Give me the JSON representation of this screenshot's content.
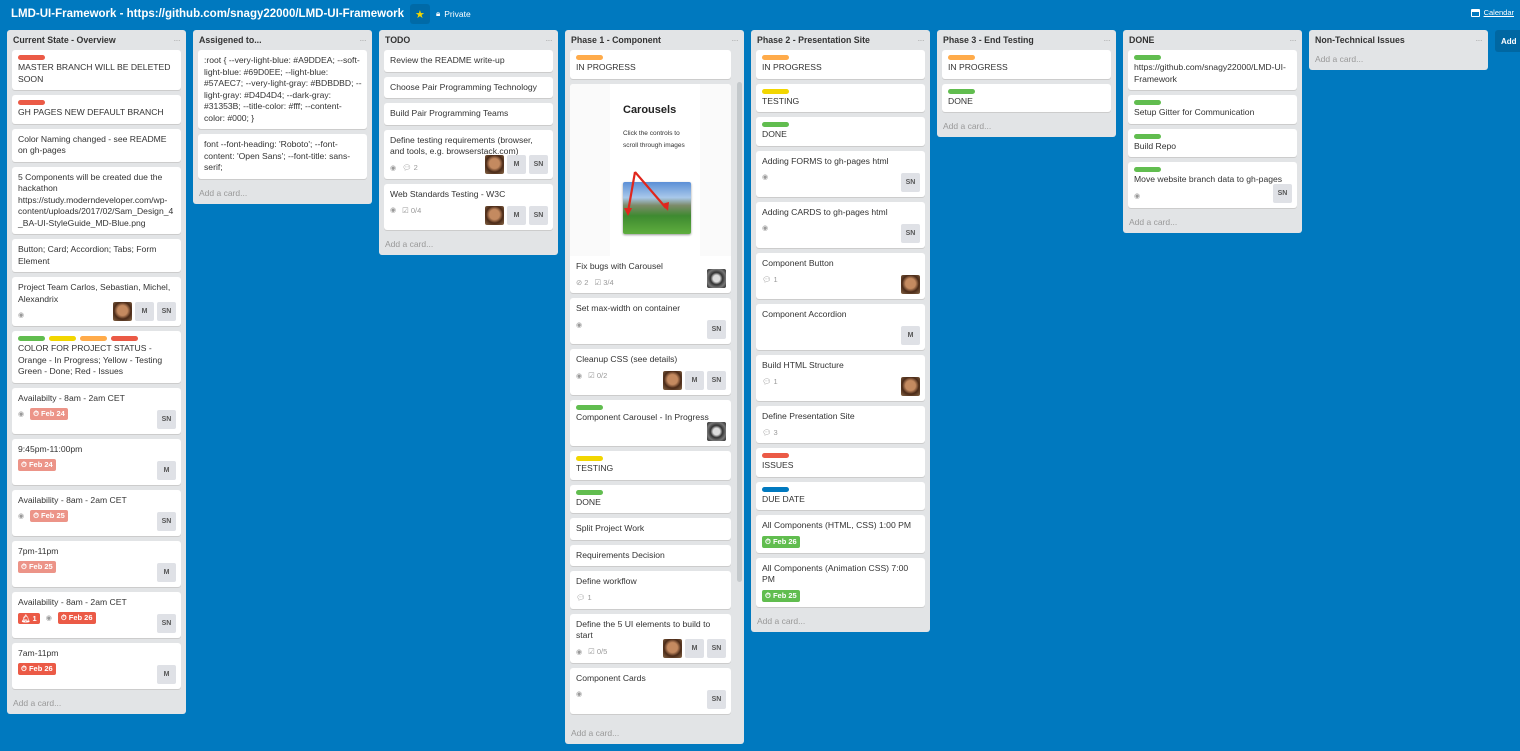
{
  "header": {
    "board_title": "LMD-UI-Framework - https://github.com/snagy22000/LMD-UI-Framework",
    "visibility": "Private",
    "calendar_label": "Calendar",
    "star_icon": "star-icon",
    "lock_icon": "lock-icon"
  },
  "label_colors": {
    "green": "#61bd4f",
    "yellow": "#f2d600",
    "orange": "#ffab4a",
    "red": "#eb5a46",
    "blue": "#0079bf"
  },
  "add_card_label": "Add a card...",
  "add_list_label": "Add",
  "lists": [
    {
      "title": "Current State - Overview",
      "cards": [
        {
          "labels": [
            "red"
          ],
          "text": "MASTER BRANCH WILL BE DELETED SOON"
        },
        {
          "labels": [
            "red"
          ],
          "text": "GH PAGES NEW DEFAULT BRANCH"
        },
        {
          "text": "Color Naming changed - see README on gh-pages"
        },
        {
          "text": "5 Components will be created due the hackathon https://study.moderndeveloper.com/wp-content/uploads/2017/02/Sam_Design_4_BA-UI-StyleGuide_MD-Blue.png"
        },
        {
          "text": "Button; Card; Accordion; Tabs; Form Element"
        },
        {
          "text": "Project Team Carlos, Sebastian, Michel, Alexandrix",
          "watch": true,
          "members": [
            "photo",
            "M",
            "SN"
          ]
        },
        {
          "labels": [
            "green",
            "yellow",
            "orange",
            "red"
          ],
          "text": "COLOR FOR PROJECT STATUS - Orange - In Progress; Yellow - Testing Green - Done; Red - Issues"
        },
        {
          "text": "Availabilty - 8am - 2am CET",
          "watch": true,
          "due": "Feb 24",
          "due_style": "light",
          "members": [
            "SN"
          ]
        },
        {
          "text": "9:45pm-11:00pm",
          "due": "Feb 24",
          "due_style": "light",
          "members": [
            "M"
          ]
        },
        {
          "text": "Availability - 8am - 2am CET",
          "watch": true,
          "due": "Feb 25",
          "due_style": "light",
          "members": [
            "SN"
          ]
        },
        {
          "text": "7pm-11pm",
          "due": "Feb 25",
          "due_style": "light",
          "members": [
            "M"
          ]
        },
        {
          "text": "Availability - 8am - 2am CET",
          "notifications": "1",
          "watch": true,
          "due": "Feb 26",
          "due_style": "red",
          "members": [
            "SN"
          ]
        },
        {
          "text": "7am-11pm",
          "due": "Feb 26",
          "due_style": "red",
          "members": [
            "M"
          ]
        }
      ]
    },
    {
      "title": "Assigened to...",
      "cards": [
        {
          "text": ":root { --very-light-blue: #A9DDEA; --soft-light-blue: #69D0EE; --light-blue: #57AEC7; --very-light-gray: #BDBDBD; --light-gray: #D4D4D4; --dark-gray: #31353B; --title-color: #fff; --content-color: #000; }"
        },
        {
          "text": "font --font-heading: 'Roboto'; --font-content: 'Open Sans'; --font-title: sans-serif;"
        }
      ]
    },
    {
      "title": "TODO",
      "cards": [
        {
          "text": "Review the README write-up"
        },
        {
          "text": "Choose Pair Programming Technology"
        },
        {
          "text": "Build Pair Programming Teams"
        },
        {
          "text": "Define testing requirements (browser, and tools, e.g. browserstack.com)",
          "watch": true,
          "comments": "2",
          "members": [
            "photo",
            "M",
            "SN"
          ]
        },
        {
          "text": "Web Standards Testing - W3C",
          "watch": true,
          "checklist": "0/4",
          "members": [
            "photo",
            "M",
            "SN"
          ]
        }
      ]
    },
    {
      "title": "Phase 1 - Component",
      "scroll": true,
      "cards": [
        {
          "labels": [
            "orange"
          ],
          "text": "IN PROGRESS"
        },
        {
          "cover": {
            "title": "Carousels",
            "desc": "Click the controls to scroll through images"
          },
          "text": "Fix bugs with Carousel",
          "attachments": "2",
          "checklist": "3/4",
          "members": [
            "photo2"
          ]
        },
        {
          "text": "Set max-width on container",
          "watch": true,
          "members": [
            "SN"
          ]
        },
        {
          "text": "Cleanup CSS (see details)",
          "watch": true,
          "checklist": "0/2",
          "members": [
            "photo",
            "M",
            "SN"
          ]
        },
        {
          "labels": [
            "green"
          ],
          "text": "Component Carousel - In Progress",
          "members": [
            "photo2"
          ]
        },
        {
          "labels": [
            "yellow"
          ],
          "text": "TESTING"
        },
        {
          "labels": [
            "green"
          ],
          "text": "DONE"
        },
        {
          "text": "Split Project Work"
        },
        {
          "text": "Requirements Decision"
        },
        {
          "text": "Define workflow",
          "comments": "1"
        },
        {
          "text": "Define the 5 UI elements to build to start",
          "watch": true,
          "checklist": "0/5",
          "members": [
            "photo",
            "M",
            "SN"
          ]
        },
        {
          "text": "Component Cards",
          "watch": true,
          "members": [
            "SN"
          ]
        }
      ]
    },
    {
      "title": "Phase 2 - Presentation Site",
      "cards": [
        {
          "labels": [
            "orange"
          ],
          "text": "IN PROGRESS"
        },
        {
          "labels": [
            "yellow"
          ],
          "text": "TESTING"
        },
        {
          "labels": [
            "green"
          ],
          "text": "DONE"
        },
        {
          "text": "Adding FORMS to gh-pages html",
          "watch": true,
          "members": [
            "SN"
          ]
        },
        {
          "text": "Adding CARDS to gh-pages html",
          "watch": true,
          "members": [
            "SN"
          ]
        },
        {
          "text": "Component Button",
          "comments": "1",
          "members": [
            "photo"
          ]
        },
        {
          "text": "Component Accordion",
          "members": [
            "M"
          ]
        },
        {
          "text": "Build HTML Structure",
          "comments": "1",
          "members": [
            "photo"
          ]
        },
        {
          "text": "Define Presentation Site",
          "comments": "3"
        },
        {
          "labels": [
            "red"
          ],
          "text": "ISSUES"
        },
        {
          "labels": [
            "blue"
          ],
          "text": "DUE DATE"
        },
        {
          "text": "All Components (HTML, CSS) 1:00 PM",
          "due": "Feb 26",
          "due_style": "green"
        },
        {
          "text": "All Components (Animation CSS) 7:00 PM",
          "due": "Feb 25",
          "due_style": "green"
        }
      ]
    },
    {
      "title": "Phase 3 - End Testing",
      "cards": [
        {
          "labels": [
            "orange"
          ],
          "text": "IN PROGRESS"
        },
        {
          "labels": [
            "green"
          ],
          "text": "DONE"
        }
      ]
    },
    {
      "title": "DONE",
      "cards": [
        {
          "labels": [
            "green"
          ],
          "text": "https://github.com/snagy22000/LMD-UI-Framework"
        },
        {
          "labels": [
            "green"
          ],
          "text": "Setup Gitter for Communication"
        },
        {
          "labels": [
            "green"
          ],
          "text": "Build Repo"
        },
        {
          "labels": [
            "green"
          ],
          "text": "Move website branch data to gh-pages",
          "watch": true,
          "members": [
            "SN"
          ]
        }
      ]
    },
    {
      "title": "Non-Technical Issues",
      "cards": []
    }
  ]
}
